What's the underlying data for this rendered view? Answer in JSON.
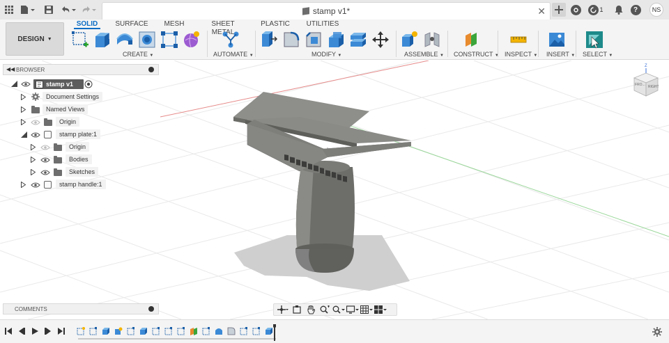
{
  "window": {
    "document_title": "stamp v1*",
    "user_initials": "NS",
    "jobs_count": "1",
    "help_label": "?"
  },
  "ribbon": {
    "workspace_button": "DESIGN",
    "tabs": [
      {
        "label": "SOLID",
        "active": true
      },
      {
        "label": "SURFACE",
        "active": false
      },
      {
        "label": "MESH",
        "active": false
      },
      {
        "label": "SHEET METAL",
        "active": false
      },
      {
        "label": "PLASTIC",
        "active": false
      },
      {
        "label": "UTILITIES",
        "active": false
      }
    ],
    "groups": {
      "create": "CREATE",
      "automate": "AUTOMATE",
      "modify": "MODIFY",
      "assemble": "ASSEMBLE",
      "construct": "CONSTRUCT",
      "inspect": "INSPECT",
      "insert": "INSERT",
      "select": "SELECT"
    },
    "accent_color": "#0b6cc4"
  },
  "browser": {
    "title": "BROWSER",
    "items": [
      {
        "label": "stamp v1",
        "level": 0,
        "icon": "document-icon",
        "expanded": true
      },
      {
        "label": "Document Settings",
        "level": 1,
        "icon": "gear-icon",
        "expanded": false
      },
      {
        "label": "Named Views",
        "level": 1,
        "icon": "folder-icon",
        "expanded": false
      },
      {
        "label": "Origin",
        "level": 1,
        "icon": "folder-icon",
        "expanded": false
      },
      {
        "label": "stamp plate:1",
        "level": 1,
        "icon": "component-icon",
        "expanded": true
      },
      {
        "label": "Origin",
        "level": 2,
        "icon": "folder-icon",
        "expanded": false
      },
      {
        "label": "Bodies",
        "level": 2,
        "icon": "folder-icon",
        "expanded": false
      },
      {
        "label": "Sketches",
        "level": 2,
        "icon": "folder-icon",
        "expanded": false
      },
      {
        "label": "stamp handle:1",
        "level": 1,
        "icon": "component-icon",
        "expanded": false
      }
    ]
  },
  "comments": {
    "title": "COMMENTS"
  },
  "viewcube": {
    "top_label": "Z",
    "front_label": "FRO...",
    "right_label": "RIGHT"
  }
}
